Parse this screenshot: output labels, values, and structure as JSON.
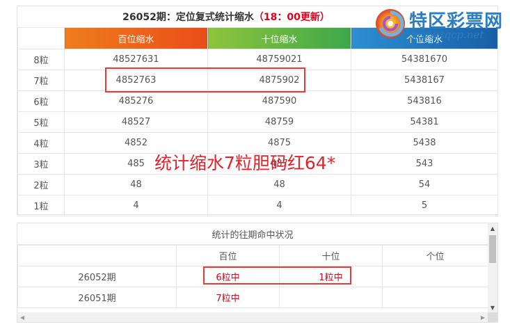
{
  "title": {
    "prefix": "26052期：定位复式统计缩水",
    "highlight": "（18：00更新）"
  },
  "logo": {
    "name": "特区彩票网",
    "url": "www.tqcp.net"
  },
  "table1": {
    "headers": [
      "",
      "百位缩水",
      "十位缩水",
      "个位缩水"
    ],
    "rows": [
      {
        "label": "8粒",
        "bai": "48527631",
        "shi": "48759021",
        "ge": "54381670"
      },
      {
        "label": "7粒",
        "bai": "4852763",
        "shi": "4875902",
        "ge": "5438167"
      },
      {
        "label": "6粒",
        "bai": "485276",
        "shi": "487590",
        "ge": "543816"
      },
      {
        "label": "5粒",
        "bai": "48527",
        "shi": "48759",
        "ge": "54381"
      },
      {
        "label": "4粒",
        "bai": "4852",
        "shi": "4875",
        "ge": "5438"
      },
      {
        "label": "3粒",
        "bai": "485",
        "shi": "487",
        "ge": "543"
      },
      {
        "label": "2粒",
        "bai": "48",
        "shi": "48",
        "ge": "54"
      },
      {
        "label": "1粒",
        "bai": "4",
        "shi": "4",
        "ge": "5"
      }
    ]
  },
  "overlay": "统计缩水7粒胆码红64*",
  "table2": {
    "title": "统计的往期命中状况",
    "headers": [
      "",
      "百位",
      "十位",
      "个位"
    ],
    "rows": [
      {
        "period": "26052期",
        "bai": "6粒中",
        "shi": "1粒中",
        "ge": ""
      },
      {
        "period": "26051期",
        "bai": "7粒中",
        "shi": "",
        "ge": ""
      }
    ]
  },
  "colors": {
    "accent_red": "#e0001b",
    "box_red": "#e33b3b",
    "bai": "#ea4d1a",
    "shi": "#3ea74a",
    "ge": "#1a5fa8"
  }
}
